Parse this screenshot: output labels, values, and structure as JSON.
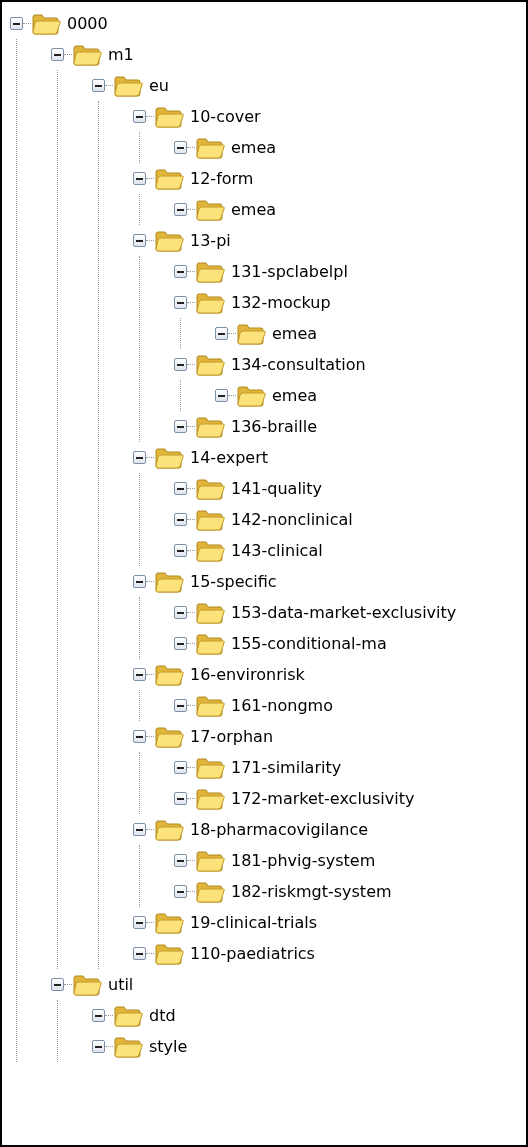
{
  "tree": [
    {
      "label": "0000",
      "expanded": true,
      "children": [
        {
          "label": "m1",
          "expanded": true,
          "children": [
            {
              "label": "eu",
              "expanded": true,
              "children": [
                {
                  "label": "10-cover",
                  "expanded": true,
                  "children": [
                    {
                      "label": "emea",
                      "expanded": true
                    }
                  ]
                },
                {
                  "label": "12-form",
                  "expanded": true,
                  "children": [
                    {
                      "label": "emea",
                      "expanded": true
                    }
                  ]
                },
                {
                  "label": "13-pi",
                  "expanded": true,
                  "children": [
                    {
                      "label": "131-spclabelpl",
                      "expanded": true
                    },
                    {
                      "label": "132-mockup",
                      "expanded": true,
                      "children": [
                        {
                          "label": "emea",
                          "expanded": true
                        }
                      ]
                    },
                    {
                      "label": "134-consultation",
                      "expanded": true,
                      "children": [
                        {
                          "label": "emea",
                          "expanded": true
                        }
                      ]
                    },
                    {
                      "label": "136-braille",
                      "expanded": true
                    }
                  ]
                },
                {
                  "label": "14-expert",
                  "expanded": true,
                  "children": [
                    {
                      "label": "141-quality",
                      "expanded": true
                    },
                    {
                      "label": "142-nonclinical",
                      "expanded": true
                    },
                    {
                      "label": "143-clinical",
                      "expanded": true
                    }
                  ]
                },
                {
                  "label": "15-specific",
                  "expanded": true,
                  "children": [
                    {
                      "label": "153-data-market-exclusivity",
                      "expanded": true
                    },
                    {
                      "label": "155-conditional-ma",
                      "expanded": true
                    }
                  ]
                },
                {
                  "label": "16-environrisk",
                  "expanded": true,
                  "children": [
                    {
                      "label": "161-nongmo",
                      "expanded": true
                    }
                  ]
                },
                {
                  "label": "17-orphan",
                  "expanded": true,
                  "children": [
                    {
                      "label": "171-similarity",
                      "expanded": true
                    },
                    {
                      "label": "172-market-exclusivity",
                      "expanded": true
                    }
                  ]
                },
                {
                  "label": "18-pharmacovigilance",
                  "expanded": true,
                  "children": [
                    {
                      "label": "181-phvig-system",
                      "expanded": true
                    },
                    {
                      "label": "182-riskmgt-system",
                      "expanded": true
                    }
                  ]
                },
                {
                  "label": "19-clinical-trials",
                  "expanded": true
                },
                {
                  "label": "110-paediatrics",
                  "expanded": true
                }
              ]
            }
          ]
        },
        {
          "label": "util",
          "expanded": true,
          "children": [
            {
              "label": "dtd",
              "expanded": true
            },
            {
              "label": "style",
              "expanded": true
            }
          ]
        }
      ]
    }
  ]
}
